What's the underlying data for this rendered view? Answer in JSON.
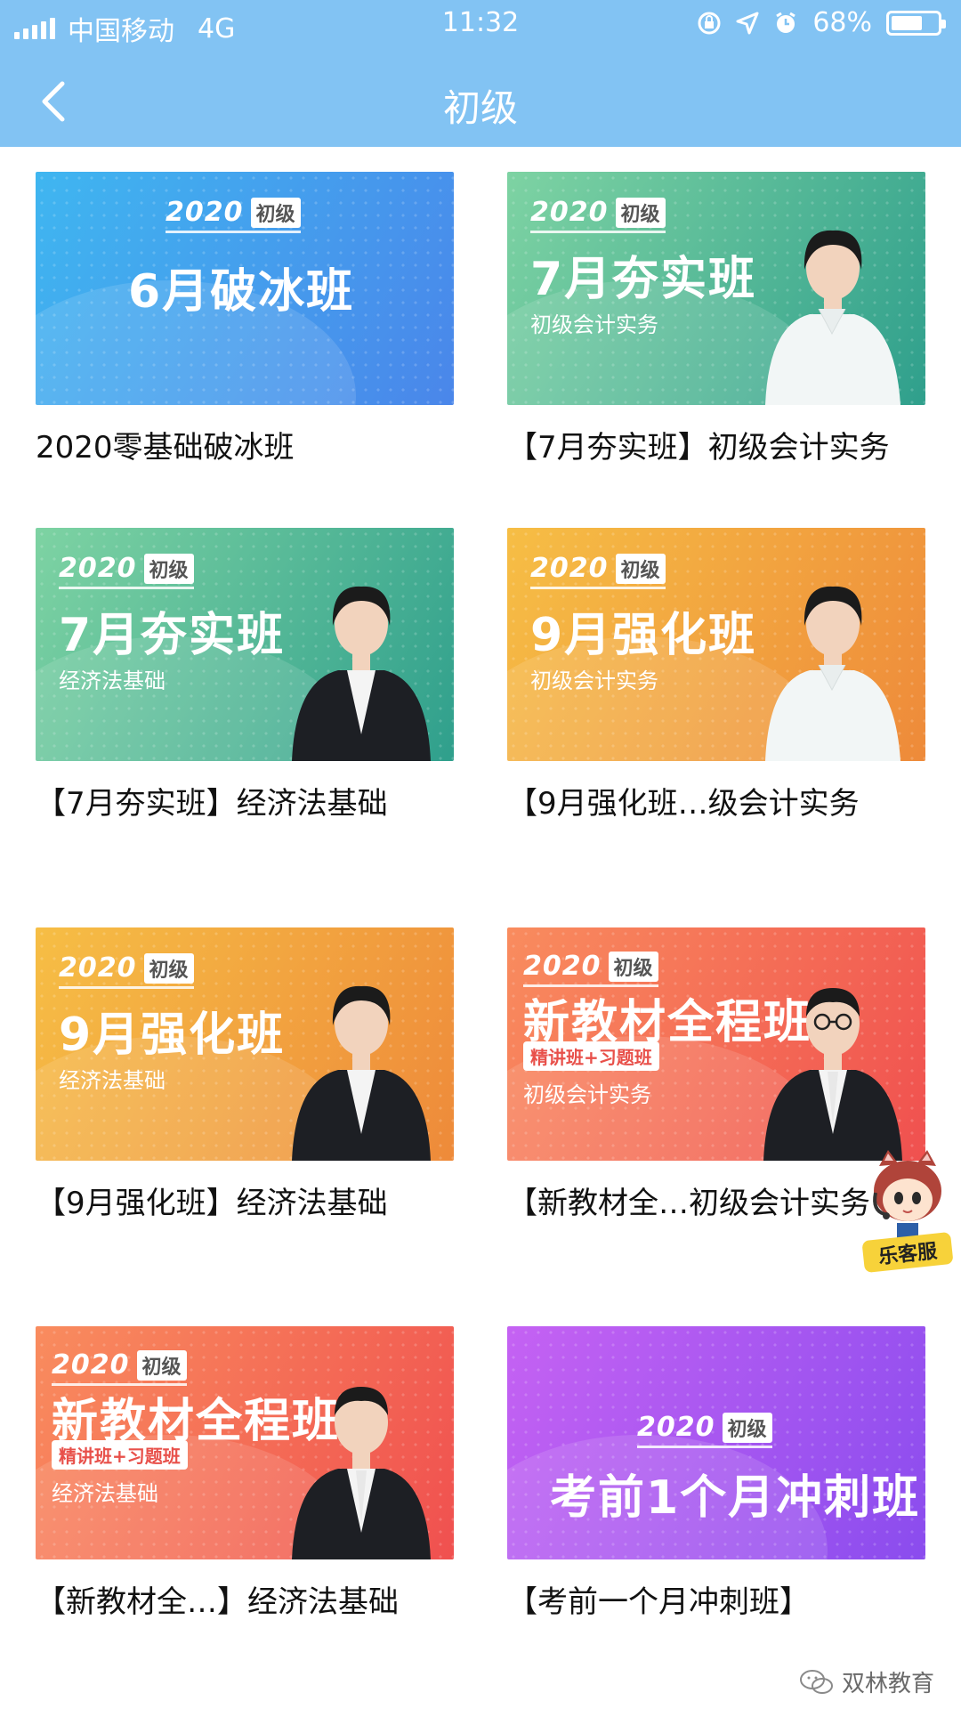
{
  "status_bar": {
    "carrier": "中国移动",
    "network": "4G",
    "time": "11:32",
    "battery_text": "68%",
    "battery_level": 0.68
  },
  "nav": {
    "title": "初级",
    "back_icon": "chevron-left-icon"
  },
  "courses": [
    {
      "year": "2020",
      "level": "初级",
      "headline": "6月破冰班",
      "subtitle": "",
      "pill": "",
      "caption": "2020零基础破冰班",
      "theme": "blue",
      "teacher": "none"
    },
    {
      "year": "2020",
      "level": "初级",
      "headline": "7月夯实班",
      "subtitle": "初级会计实务",
      "pill": "",
      "caption": "【7月夯实班】初级会计实务",
      "theme": "green",
      "teacher": "woman-white"
    },
    {
      "year": "2020",
      "level": "初级",
      "headline": "7月夯实班",
      "subtitle": "经济法基础",
      "pill": "",
      "caption": "【7月夯实班】经济法基础",
      "theme": "green",
      "teacher": "woman-dark"
    },
    {
      "year": "2020",
      "level": "初级",
      "headline": "9月强化班",
      "subtitle": "初级会计实务",
      "pill": "",
      "caption": "【9月强化班…级会计实务",
      "theme": "orange",
      "teacher": "woman-white"
    },
    {
      "year": "2020",
      "level": "初级",
      "headline": "9月强化班",
      "subtitle": "经济法基础",
      "pill": "",
      "caption": "【9月强化班】经济法基础",
      "theme": "orange",
      "teacher": "woman-dark"
    },
    {
      "year": "2020",
      "level": "初级",
      "headline": "新教材全程班",
      "subtitle": "初级会计实务",
      "pill": "精讲班+习题班",
      "caption": "【新教材全…初级会计实务",
      "theme": "coral",
      "teacher": "man-glasses"
    },
    {
      "year": "2020",
      "level": "初级",
      "headline": "新教材全程班",
      "subtitle": "经济法基础",
      "pill": "精讲班+习题班",
      "caption": "【新教材全…】经济法基础",
      "theme": "coral",
      "teacher": "man-dark"
    },
    {
      "year": "2020",
      "level": "初级",
      "headline": "考前1个月冲刺班",
      "subtitle": "",
      "pill": "",
      "caption": "【考前一个月冲刺班】",
      "theme": "purple",
      "teacher": "none"
    }
  ],
  "theme_colors": {
    "blue": [
      "#3fb6f0",
      "#4a86ea"
    ],
    "green": [
      "#7ed3a3",
      "#2f9f8c"
    ],
    "orange": [
      "#f6be45",
      "#ee8a3a"
    ],
    "coral": [
      "#f98c5e",
      "#f0504f"
    ],
    "purple": [
      "#c562f3",
      "#8a4cee"
    ]
  },
  "customer_service": {
    "label": "乐客服",
    "icon": "cat-mascot-icon"
  },
  "watermark": {
    "text": "双林教育",
    "icon": "wechat-icon"
  }
}
